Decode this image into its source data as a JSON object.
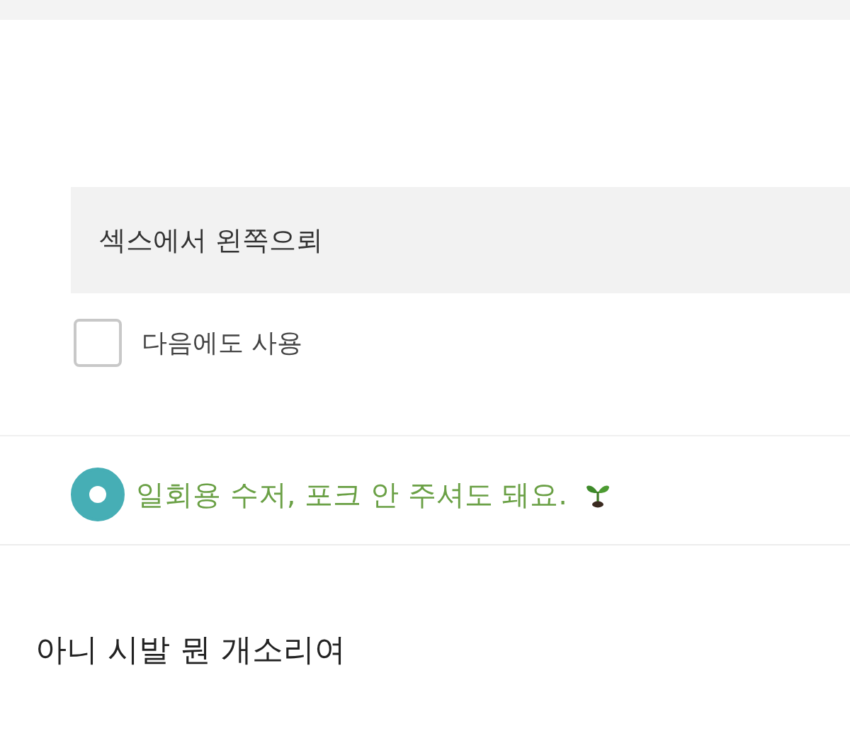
{
  "request_field": {
    "value": "섹스에서 왼쪽으뢰"
  },
  "reuse_checkbox": {
    "label": "다음에도 사용",
    "checked": false
  },
  "no_utensils_option": {
    "label": "일회용 수저, 포크 안 주셔도 돼요.",
    "selected": true
  },
  "caption": "아니 시발 뭔 개소리여"
}
